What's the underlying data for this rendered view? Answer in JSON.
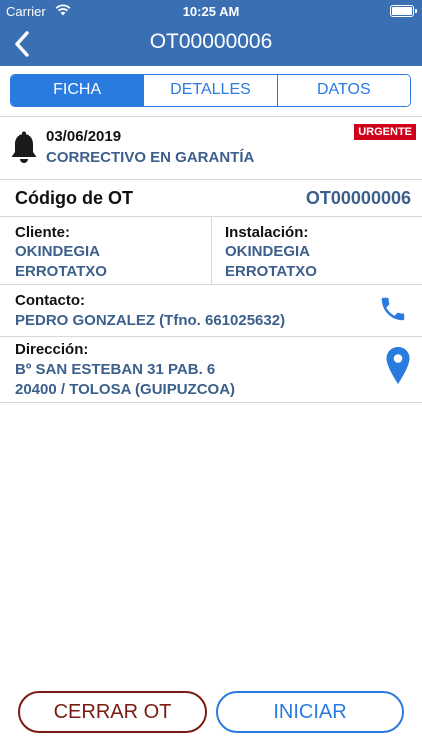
{
  "status_bar": {
    "carrier": "Carrier",
    "time": "10:25 AM"
  },
  "nav": {
    "title": "OT00000006"
  },
  "tabs": [
    {
      "label": "FICHA",
      "active": true
    },
    {
      "label": "DETALLES",
      "active": false
    },
    {
      "label": "DATOS",
      "active": false
    }
  ],
  "order": {
    "date": "03/06/2019",
    "type": "CORRECTIVO EN GARANTÍA",
    "badge": "URGENTE",
    "code_label": "Código de OT",
    "code_value": "OT00000006"
  },
  "cliente": {
    "label": "Cliente:",
    "line1": "OKINDEGIA",
    "line2": "ERROTATXO"
  },
  "instalacion": {
    "label": "Instalación:",
    "line1": "OKINDEGIA",
    "line2": "ERROTATXO"
  },
  "contacto": {
    "label": "Contacto:",
    "value": "PEDRO GONZALEZ (Tfno. 661025632)"
  },
  "direccion": {
    "label": "Dirección:",
    "line1": "Bº SAN ESTEBAN 31 PAB. 6",
    "line2": "20400 / TOLOSA (GUIPUZCOA)"
  },
  "buttons": {
    "close": "CERRAR OT",
    "start": "INICIAR"
  },
  "colors": {
    "primary": "#3a6fb3",
    "accent": "#2a7be0",
    "value_text": "#3c5f8c",
    "urgent": "#d0021b",
    "close_button": "#7a1b12"
  },
  "icons": [
    "wifi-icon",
    "battery-icon",
    "back-chevron-icon",
    "bell-icon",
    "phone-icon",
    "location-pin-icon"
  ]
}
